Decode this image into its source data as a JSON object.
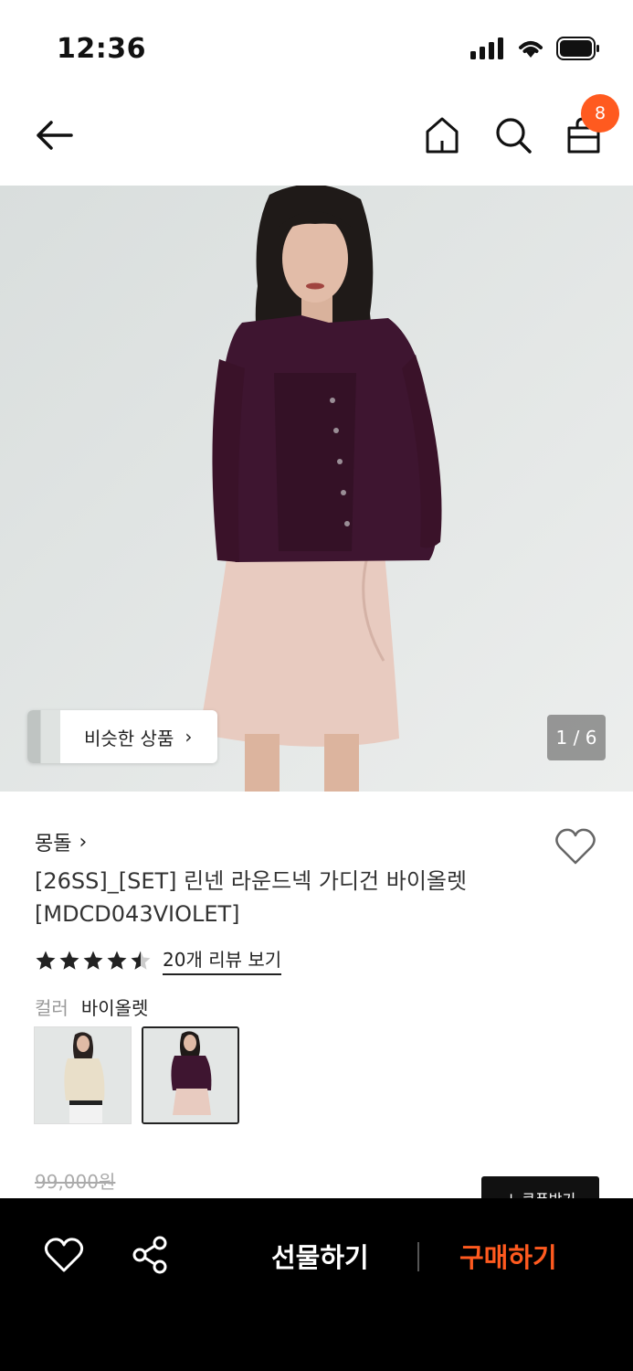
{
  "status_bar": {
    "time": "12:36",
    "icons": [
      "signal-icon",
      "wifi-icon",
      "battery-icon"
    ]
  },
  "nav": {
    "icons": [
      "back-arrow-icon",
      "home-icon",
      "search-icon",
      "shopping-bag-icon"
    ],
    "cart_count": "8"
  },
  "hero": {
    "similar_products_label": "비슷한 상품",
    "similar_chevron": "›",
    "page_counter": "1 / 6"
  },
  "product": {
    "brand": "몽돌",
    "brand_chevron": "›",
    "name_line1": "[26SS]_[SET] 린넨 라운드넥 가디건 바이올렛",
    "name_line2": "[MDCD043VIOLET]",
    "rating": 4.5,
    "review_link": "20개 리뷰 보기",
    "color_label": "컬러",
    "color_value": "바이올렛",
    "original_price": "99,000원",
    "coupon_label": "↓ 쿠폰받기"
  },
  "bottom_bar": {
    "gift_label": "선물하기",
    "buy_label": "구매하기"
  },
  "colors": {
    "accent": "#ff5a1f",
    "bottom_bar_bg": "#000000"
  }
}
